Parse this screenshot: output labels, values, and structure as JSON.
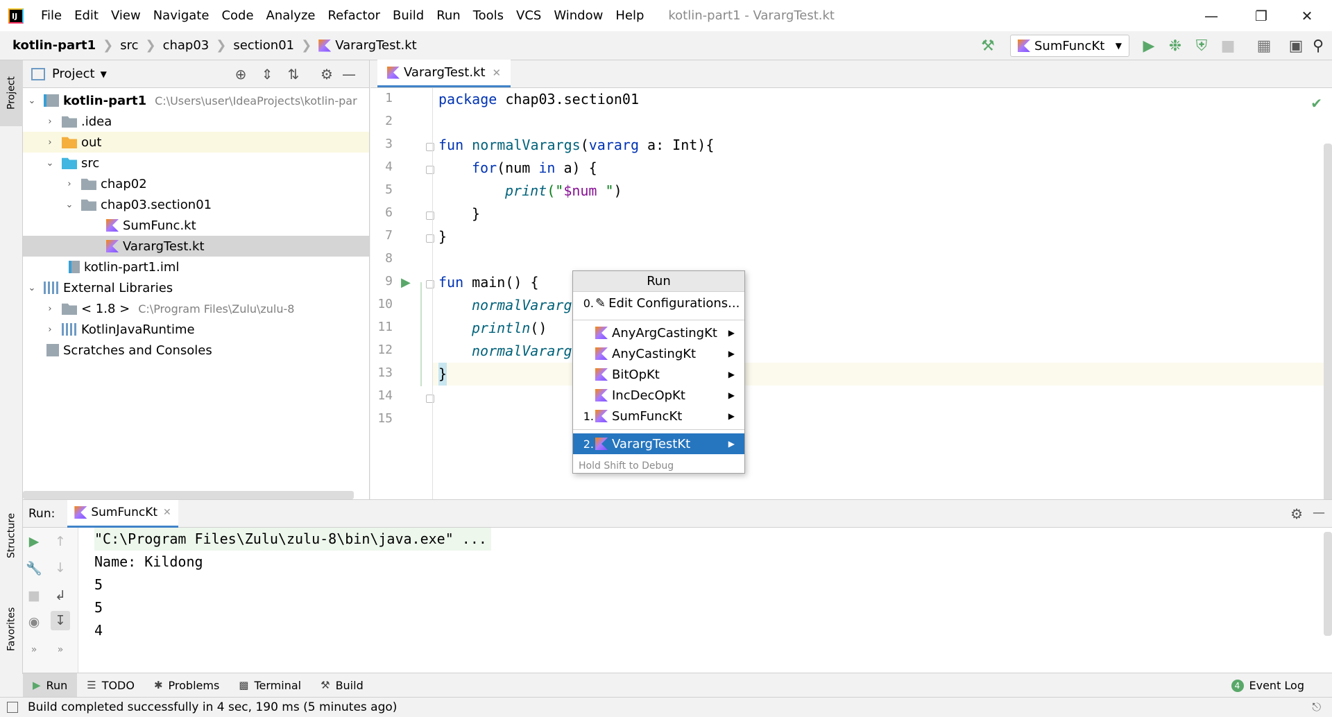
{
  "menubar": {
    "logo": "IJ",
    "items": [
      "File",
      "Edit",
      "View",
      "Navigate",
      "Code",
      "Analyze",
      "Refactor",
      "Build",
      "Run",
      "Tools",
      "VCS",
      "Window",
      "Help"
    ],
    "title": "kotlin-part1 - VarargTest.kt"
  },
  "breadcrumbs": [
    "kotlin-part1",
    "src",
    "chap03",
    "section01",
    "VarargTest.kt"
  ],
  "toolbar": {
    "run_config": "SumFuncKt"
  },
  "stripe": {
    "project": "Project",
    "structure": "Structure",
    "favorites": "Favorites"
  },
  "project_panel": {
    "title": "Project",
    "tree": [
      {
        "label": "kotlin-part1",
        "path": "C:\\Users\\user\\IdeaProjects\\kotlin-par"
      },
      {
        "label": ".idea"
      },
      {
        "label": "out"
      },
      {
        "label": "src"
      },
      {
        "label": "chap02"
      },
      {
        "label": "chap03.section01"
      },
      {
        "label": "SumFunc.kt"
      },
      {
        "label": "VarargTest.kt"
      },
      {
        "label": "kotlin-part1.iml"
      },
      {
        "label": "External Libraries"
      },
      {
        "label": "< 1.8 >",
        "path": "C:\\Program Files\\Zulu\\zulu-8"
      },
      {
        "label": "KotlinJavaRuntime"
      },
      {
        "label": "Scratches and Consoles"
      }
    ]
  },
  "editor": {
    "tab": "VarargTest.kt",
    "line_numbers": [
      "1",
      "2",
      "3",
      "4",
      "5",
      "6",
      "7",
      "8",
      "9",
      "10",
      "11",
      "12",
      "13",
      "14",
      "15"
    ],
    "code": {
      "l1_kw": "package",
      "l1_rest": " chap03.section01",
      "l3_kw": "fun",
      "l3_fn": " normalVarargs",
      "l3_p1": "(",
      "l3_kw2": "vararg",
      "l3_rest": " a: Int){",
      "l4_kw": "for",
      "l4_p": "(num ",
      "l4_kw2": "in",
      "l4_rest": " a) {",
      "l5_fn": "print",
      "l5_str1": "(\"",
      "l5_var": "$num",
      "l5_str2": " \"",
      "l5_p": ")",
      "l6": "}",
      "l7": "}",
      "l9_kw": "fun",
      "l9_rest": " main() {",
      "l10": "normalVararg",
      "l11_fn": "println",
      "l11_rest": "()",
      "l12": "normalVararg",
      "l13": "}"
    }
  },
  "run_popup": {
    "title": "Run",
    "edit_num": "0.",
    "edit_label": "Edit Configurations...",
    "items": [
      {
        "num": "",
        "label": "AnyArgCastingKt"
      },
      {
        "num": "",
        "label": "AnyCastingKt"
      },
      {
        "num": "",
        "label": "BitOpKt"
      },
      {
        "num": "",
        "label": "IncDecOpKt"
      },
      {
        "num": "1.",
        "label": "SumFuncKt"
      },
      {
        "num": "2.",
        "label": "VarargTestKt"
      }
    ],
    "hint": "Hold Shift to Debug"
  },
  "run_panel": {
    "label": "Run:",
    "tab": "SumFuncKt",
    "console": [
      "\"C:\\Program Files\\Zulu\\zulu-8\\bin\\java.exe\" ...",
      "Name: Kildong",
      "5",
      "5",
      "4"
    ]
  },
  "tool_tabs": {
    "run": "Run",
    "todo": "TODO",
    "problems": "Problems",
    "terminal": "Terminal",
    "build": "Build",
    "event_log": "Event Log",
    "event_count": "4"
  },
  "status": {
    "text": "Build completed successfully in 4 sec, 190 ms (5 minutes ago)"
  }
}
